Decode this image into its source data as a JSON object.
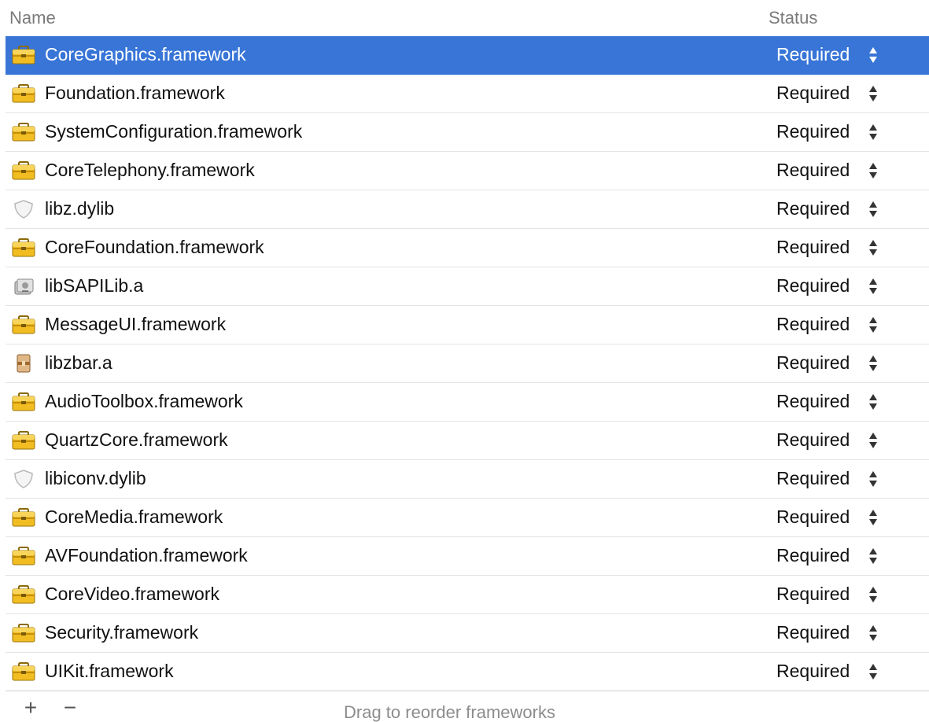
{
  "header": {
    "name_label": "Name",
    "status_label": "Status"
  },
  "frameworks": [
    {
      "name": "CoreGraphics.framework",
      "status": "Required",
      "icon": "toolbox-icon",
      "selected": true
    },
    {
      "name": "Foundation.framework",
      "status": "Required",
      "icon": "toolbox-icon"
    },
    {
      "name": "SystemConfiguration.framework",
      "status": "Required",
      "icon": "toolbox-icon"
    },
    {
      "name": "CoreTelephony.framework",
      "status": "Required",
      "icon": "toolbox-icon"
    },
    {
      "name": "libz.dylib",
      "status": "Required",
      "icon": "shield-icon"
    },
    {
      "name": "CoreFoundation.framework",
      "status": "Required",
      "icon": "toolbox-icon"
    },
    {
      "name": "libSAPILib.a",
      "status": "Required",
      "icon": "library-icon"
    },
    {
      "name": "MessageUI.framework",
      "status": "Required",
      "icon": "toolbox-icon"
    },
    {
      "name": "libzbar.a",
      "status": "Required",
      "icon": "archive-icon"
    },
    {
      "name": "AudioToolbox.framework",
      "status": "Required",
      "icon": "toolbox-icon"
    },
    {
      "name": "QuartzCore.framework",
      "status": "Required",
      "icon": "toolbox-icon"
    },
    {
      "name": "libiconv.dylib",
      "status": "Required",
      "icon": "shield-icon"
    },
    {
      "name": "CoreMedia.framework",
      "status": "Required",
      "icon": "toolbox-icon"
    },
    {
      "name": "AVFoundation.framework",
      "status": "Required",
      "icon": "toolbox-icon"
    },
    {
      "name": "CoreVideo.framework",
      "status": "Required",
      "icon": "toolbox-icon"
    },
    {
      "name": "Security.framework",
      "status": "Required",
      "icon": "toolbox-icon"
    },
    {
      "name": "UIKit.framework",
      "status": "Required",
      "icon": "toolbox-icon"
    }
  ],
  "footer": {
    "add_label": "+",
    "remove_label": "−",
    "hint": "Drag to reorder frameworks"
  },
  "colors": {
    "selection": "#3875d7",
    "toolbox": "#e8b21a"
  }
}
